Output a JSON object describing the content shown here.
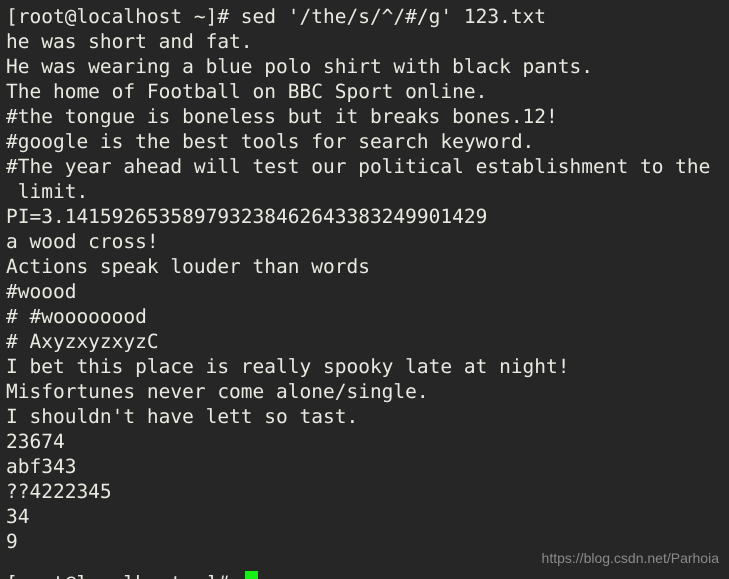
{
  "terminal": {
    "background_color": "#262626",
    "foreground_color": "#e9e9e1",
    "cursor_color": "#16f016",
    "prompt": "[root@localhost ~]#",
    "command": "sed '/the/s/^/#/g' 123.txt",
    "lines": [
      "[root@localhost ~]# sed '/the/s/^/#/g' 123.txt",
      "he was short and fat.",
      "He was wearing a blue polo shirt with black pants.",
      "The home of Football on BBC Sport online.",
      "#the tongue is boneless but it breaks bones.12!",
      "#google is the best tools for search keyword.",
      "#The year ahead will test our political establishment to the",
      " limit.",
      "PI=3.141592653589793238462643383249901429",
      "a wood cross!",
      "Actions speak louder than words",
      "#woood",
      "# #woooooood",
      "# AxyzxyzxyzC",
      "I bet this place is really spooky late at night!",
      "Misfortunes never come alone/single.",
      "I shouldn't have lett so tast.",
      "23674",
      "abf343",
      "??4222345",
      "34",
      "9"
    ]
  },
  "watermark": {
    "text": "https://blog.csdn.net/Parhoia"
  }
}
